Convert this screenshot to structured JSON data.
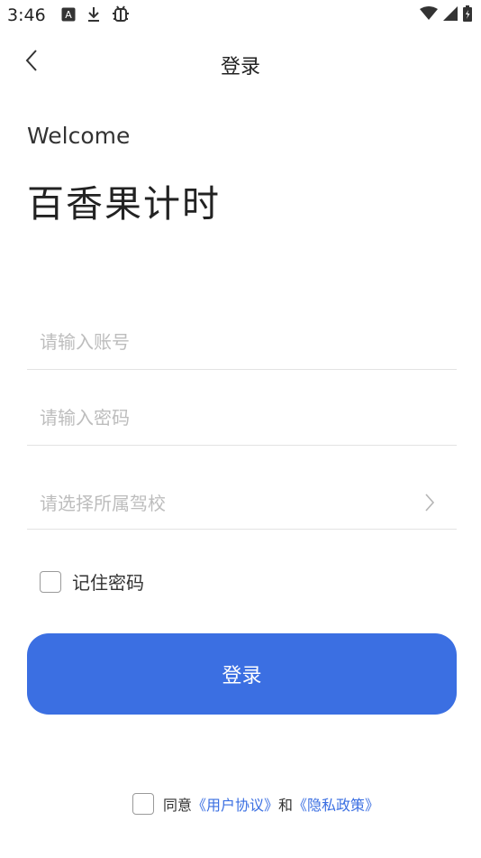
{
  "status_bar": {
    "time": "3:46",
    "left_icons": [
      "notification-a-icon",
      "download-icon",
      "debug-bug-icon"
    ],
    "right_icons": [
      "wifi-icon",
      "signal-icon",
      "battery-icon"
    ]
  },
  "nav": {
    "title": "登录",
    "back_icon": "chevron-left-icon"
  },
  "header": {
    "welcome": "Welcome",
    "app_name": "百香果计时"
  },
  "form": {
    "account": {
      "placeholder": "请输入账号",
      "value": ""
    },
    "password": {
      "placeholder": "请输入密码",
      "value": ""
    },
    "school": {
      "placeholder": "请选择所属驾校",
      "chevron_icon": "chevron-right-icon"
    },
    "remember_label": "记住密码",
    "remember_checked": false,
    "submit_label": "登录"
  },
  "agreement": {
    "checked": false,
    "prefix": "同意",
    "user_agreement": "《用户协议》",
    "conjunction": "和",
    "privacy_policy": "《隐私政策》"
  },
  "colors": {
    "accent": "#3b6fe2",
    "placeholder": "#bdbdbd",
    "divider": "#e3e3e3"
  }
}
